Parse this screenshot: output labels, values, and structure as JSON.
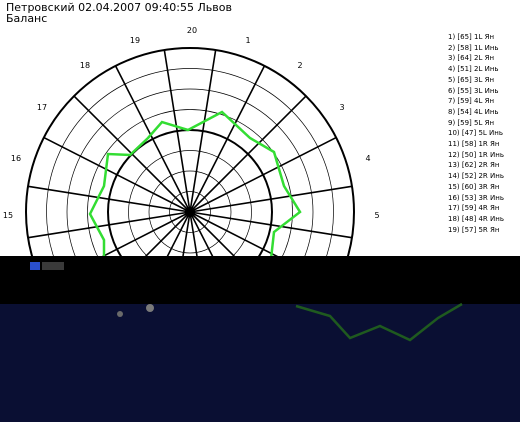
{
  "header": {
    "line1": "Петровский 02.04.2007 09:40:55 Львов",
    "line2": "Баланс"
  },
  "polar": {
    "sector_labels": [
      "20",
      "1",
      "2",
      "3",
      "4",
      "5",
      "15",
      "16",
      "17",
      "18",
      "19"
    ],
    "rings": 8,
    "spokes": 20,
    "colors": {
      "grid": "#000000",
      "trace": "#33dd33",
      "bg": "#ffffff"
    }
  },
  "legend": [
    "1) [65]  1L Ян",
    "2) [58]  1L Инь",
    "3) [64]  2L Ян",
    "4) [51]  2L Инь",
    "5) [65]  3L Ян",
    "6) [55]  3L Инь",
    "7) [59]  4L Ян",
    "8) [54]  4L Инь",
    "9) [59]  5L Ян",
    "10) [47]  5L Инь",
    "11) [58]  1R Ян",
    "12) [50]  1R Инь",
    "13) [62]  2R Ян",
    "14) [52]  2R Инь",
    "15) [60]  3R Ян",
    "16) [53]  3R Инь",
    "17) [59]  4R Ян",
    "18) [48]  4R Инь",
    "19) [57]  5R Ян"
  ],
  "bottom_panel": {
    "colors": {
      "band": "#000000",
      "panel": "#0a0f33",
      "line": "#1f5a1f"
    }
  }
}
